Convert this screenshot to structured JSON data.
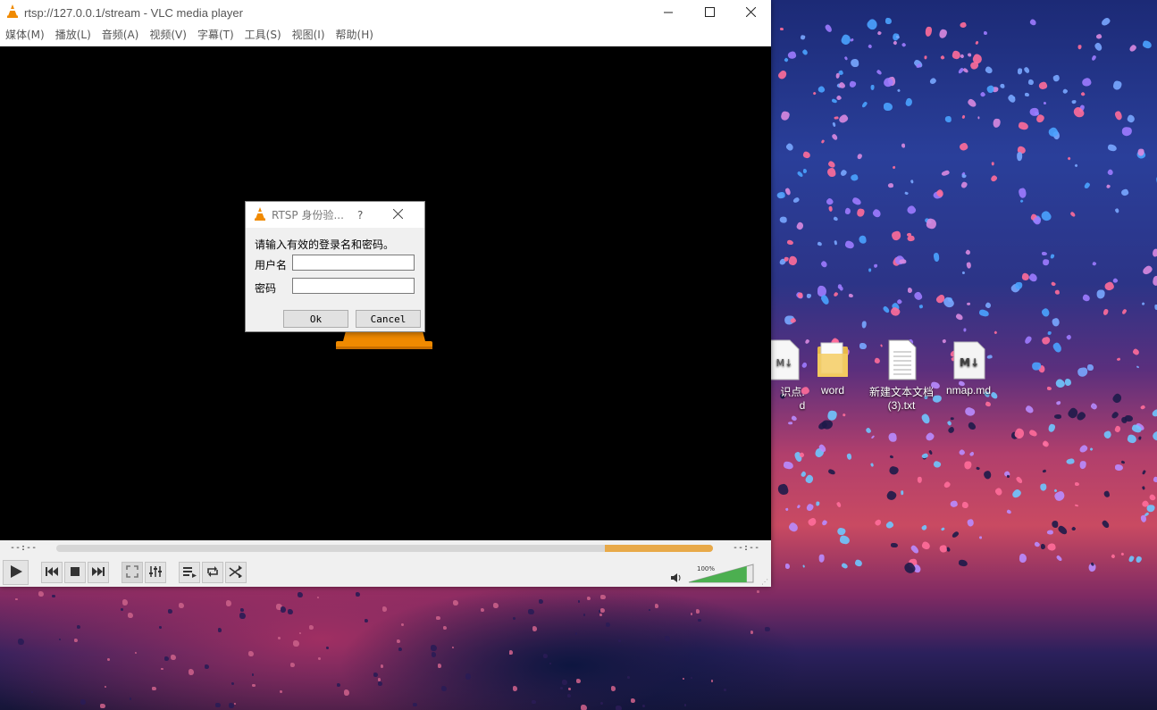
{
  "window": {
    "title": "rtsp://127.0.0.1/stream - VLC media player",
    "minimize_icon": "minimize-icon",
    "maximize_icon": "maximize-icon",
    "close_icon": "close-icon"
  },
  "menu": {
    "items": [
      "媒体(M)",
      "播放(L)",
      "音频(A)",
      "视频(V)",
      "字幕(T)",
      "工具(S)",
      "视图(I)",
      "帮助(H)"
    ]
  },
  "controls": {
    "time_elapsed": "--:--",
    "time_total": "--:--",
    "volume_percent": "100%",
    "volume_level": 1.0,
    "seek_buffer_fraction": 0.165,
    "buttons": [
      "play-icon",
      "previous-icon",
      "stop-icon",
      "next-icon",
      "fullscreen-icon",
      "extended-settings-icon",
      "playlist-icon",
      "loop-icon",
      "shuffle-icon"
    ]
  },
  "dialog": {
    "title": "RTSP 身份验...",
    "help": "?",
    "prompt": "请输入有效的登录名和密码。",
    "username_label": "用户名",
    "username_value": "",
    "password_label": "密码",
    "password_value": "",
    "ok_label": "Ok",
    "cancel_label": "Cancel"
  },
  "desktop": {
    "icons": [
      {
        "name": "知识点.md (partial)",
        "label1": "识点.",
        "label2": "d"
      },
      {
        "name": "word",
        "label1": "word",
        "label2": ""
      },
      {
        "name": "新建文本文档",
        "label1": "新建文本文档",
        "label2": "(3).txt"
      },
      {
        "name": "nmap.md",
        "label1": "nmap.md",
        "label2": ""
      }
    ]
  },
  "colors": {
    "vlc_orange": "#f08a00",
    "seek_buffer": "#e8a948",
    "volume_green": "#4caf50"
  }
}
